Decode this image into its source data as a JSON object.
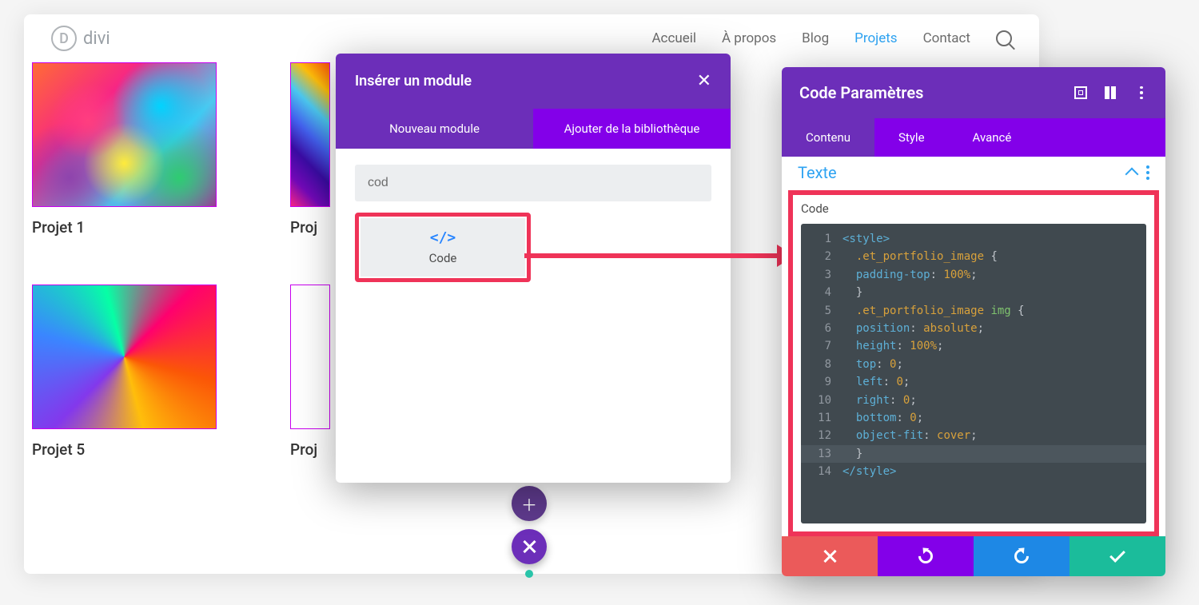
{
  "brand": "divi",
  "nav": {
    "accueil": "Accueil",
    "apropos": "À propos",
    "blog": "Blog",
    "projets": "Projets",
    "contact": "Contact"
  },
  "portfolio": {
    "p1": "Projet 1",
    "p2": "Proj",
    "p5": "Projet 5",
    "p6": "Proj"
  },
  "insertModal": {
    "title": "Insérer un module",
    "tabNew": "Nouveau module",
    "tabLibrary": "Ajouter de la bibliothèque",
    "searchValue": "cod",
    "codeIcon": "</>",
    "codeLabel": "Code"
  },
  "settings": {
    "title": "Code Paramètres",
    "tabContent": "Contenu",
    "tabStyle": "Style",
    "tabAdvanced": "Avancé",
    "sectionTexte": "Texte",
    "fieldCode": "Code",
    "code": {
      "l1": "<style>",
      "l2_sel": ".et_portfolio_image",
      "l2_b": " {",
      "l3_p": "padding-top",
      "l3_v": "100%",
      "l4": "}",
      "l5_sel": ".et_portfolio_image",
      "l5_sel2": " img",
      "l5_b": " {",
      "l6_p": "position",
      "l6_v": "absolute",
      "l7_p": "height",
      "l7_v": "100%",
      "l8_p": "top",
      "l8_v": "0",
      "l9_p": "left",
      "l9_v": "0",
      "l10_p": "right",
      "l10_v": "0",
      "l11_p": "bottom",
      "l11_v": "0",
      "l12_p": "object-fit",
      "l12_v": "cover",
      "l13": "}",
      "l14": "</style>"
    },
    "lineNumbers": {
      "n1": "1",
      "n2": "2",
      "n3": "3",
      "n4": "4",
      "n5": "5",
      "n6": "6",
      "n7": "7",
      "n8": "8",
      "n9": "9",
      "n10": "10",
      "n11": "11",
      "n12": "12",
      "n13": "13",
      "n14": "14"
    }
  }
}
